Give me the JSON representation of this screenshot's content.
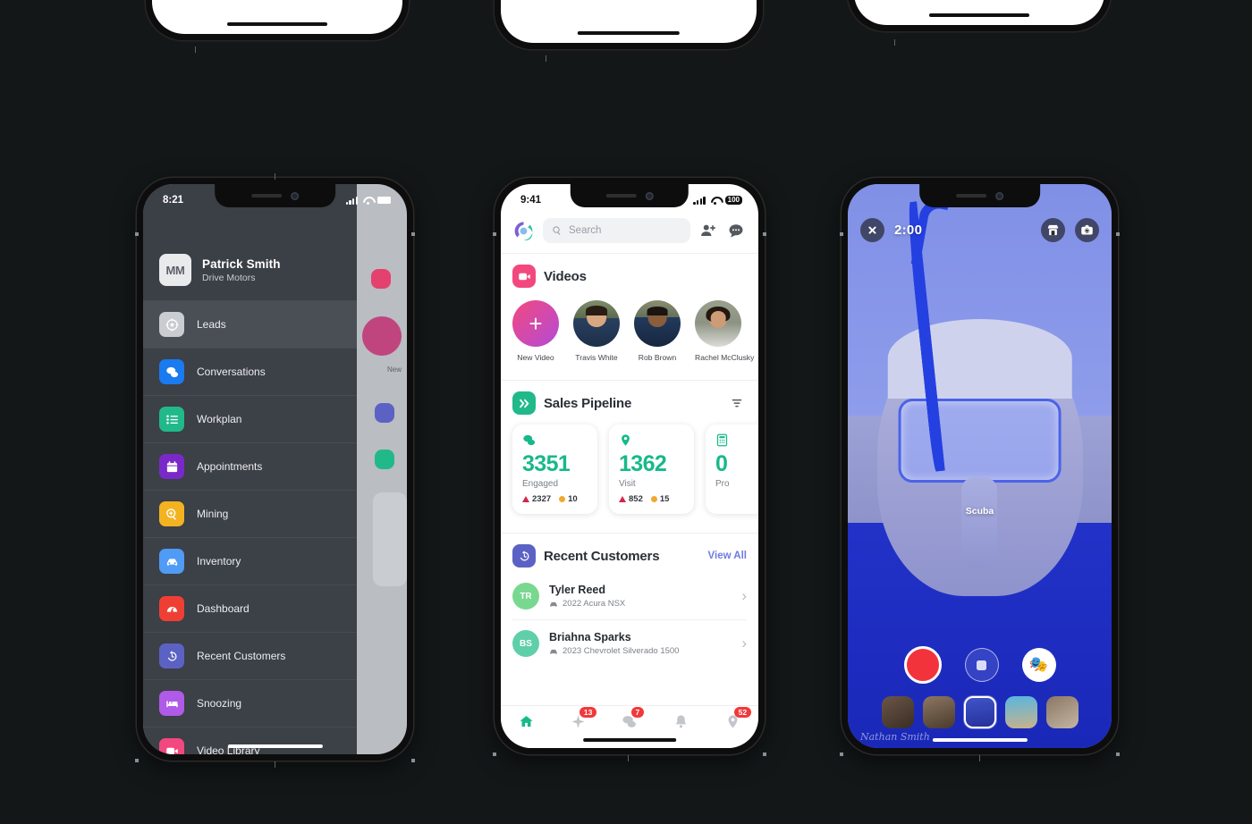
{
  "background_color": "#131718",
  "phones_cut_off_top": [
    {
      "name": "phone-top-left"
    },
    {
      "name": "phone-top-center"
    },
    {
      "name": "phone-top-right"
    }
  ],
  "left_phone": {
    "status_bar": {
      "time": "8:21",
      "battery": ""
    },
    "profile": {
      "initials": "MM",
      "name": "Patrick Smith",
      "company": "Drive Motors"
    },
    "menu_items": [
      {
        "label": "Leads",
        "icon": "target-icon",
        "color": "#c9ccd1",
        "selected": true
      },
      {
        "label": "Conversations",
        "icon": "chat-bubbles-icon",
        "color": "#1a7af0",
        "selected": false
      },
      {
        "label": "Workplan",
        "icon": "list-icon",
        "color": "#21b98a",
        "selected": false
      },
      {
        "label": "Appointments",
        "icon": "calendar-icon",
        "color": "#7a29c9",
        "selected": false
      },
      {
        "label": "Mining",
        "icon": "magnifier-plus-icon",
        "color": "#f3b321",
        "selected": false
      },
      {
        "label": "Inventory",
        "icon": "car-icon",
        "color": "#4f9bf5",
        "selected": false
      },
      {
        "label": "Dashboard",
        "icon": "gauge-icon",
        "color": "#ef3f34",
        "selected": false
      },
      {
        "label": "Recent Customers",
        "icon": "history-icon",
        "color": "#5b62c4",
        "selected": false
      },
      {
        "label": "Snoozing",
        "icon": "bed-icon",
        "color": "#b05ae8",
        "selected": false
      },
      {
        "label": "Video Library",
        "icon": "video-icon",
        "color": "#f2487f",
        "selected": false
      }
    ]
  },
  "center_phone": {
    "status_bar": {
      "time": "9:41",
      "battery": "100"
    },
    "search": {
      "placeholder": "Search",
      "value": ""
    },
    "header_icons": [
      "logo-icon",
      "search-icon",
      "add-contact-icon",
      "message-icon"
    ],
    "videos": {
      "title": "Videos",
      "icon": "video-camera-icon",
      "icon_color": "#f2487f",
      "stories": [
        {
          "label": "New Video",
          "type": "new"
        },
        {
          "label": "Travis White",
          "type": "avatar"
        },
        {
          "label": "Rob Brown",
          "type": "avatar"
        },
        {
          "label": "Rachel McClusky",
          "type": "avatar"
        }
      ]
    },
    "sales_pipeline": {
      "title": "Sales Pipeline",
      "icon": "chevrons-right-icon",
      "icon_color": "#21b98a",
      "filter_icon": "filter-icon",
      "cards": [
        {
          "icon": "chat-bubbles-icon",
          "value": "3351",
          "name": "Engaged",
          "alert": "2327",
          "warn": "10"
        },
        {
          "icon": "map-pin-icon",
          "value": "1362",
          "name": "Visit",
          "alert": "852",
          "warn": "15"
        },
        {
          "icon": "calculator-icon",
          "value": "0",
          "name": "Pro",
          "alert": "",
          "warn": ""
        }
      ]
    },
    "recent_customers": {
      "title": "Recent Customers",
      "icon": "history-icon",
      "icon_color": "#5b62c4",
      "view_all": "View All",
      "rows": [
        {
          "initials": "TR",
          "name": "Tyler Reed",
          "vehicle": "2022 Acura NSX",
          "color": "#79d88f"
        },
        {
          "initials": "BS",
          "name": "Briahna Sparks",
          "vehicle": "2023 Chevrolet Silverado 1500",
          "color": "#5fcfa9"
        }
      ]
    },
    "tabs": [
      {
        "icon": "home-icon",
        "badge": "",
        "active": true
      },
      {
        "icon": "sparkle-icon",
        "badge": "13",
        "active": false
      },
      {
        "icon": "chat-icon",
        "badge": "7",
        "active": false
      },
      {
        "icon": "bell-icon",
        "badge": "",
        "active": false
      },
      {
        "icon": "pin-icon",
        "badge": "52",
        "active": false
      }
    ]
  },
  "right_phone": {
    "close_icon": "close-icon",
    "timer": "2:00",
    "top_right_icons": [
      "store-icon",
      "camera-flip-icon"
    ],
    "filter_name": "Scuba",
    "controls": [
      {
        "name": "record-button",
        "icon": "record-icon"
      },
      {
        "name": "stop-button",
        "icon": "stop-icon"
      },
      {
        "name": "effects-button",
        "icon": "theater-masks-icon",
        "glyph": "🎭"
      }
    ],
    "filter_thumbnails": [
      {
        "name": "filter-thumb-1",
        "selected": false
      },
      {
        "name": "filter-thumb-2",
        "selected": false
      },
      {
        "name": "filter-thumb-3",
        "selected": true
      },
      {
        "name": "filter-thumb-4",
        "selected": false
      },
      {
        "name": "filter-thumb-5",
        "selected": false
      }
    ],
    "watermark": "Nathan Smith"
  }
}
